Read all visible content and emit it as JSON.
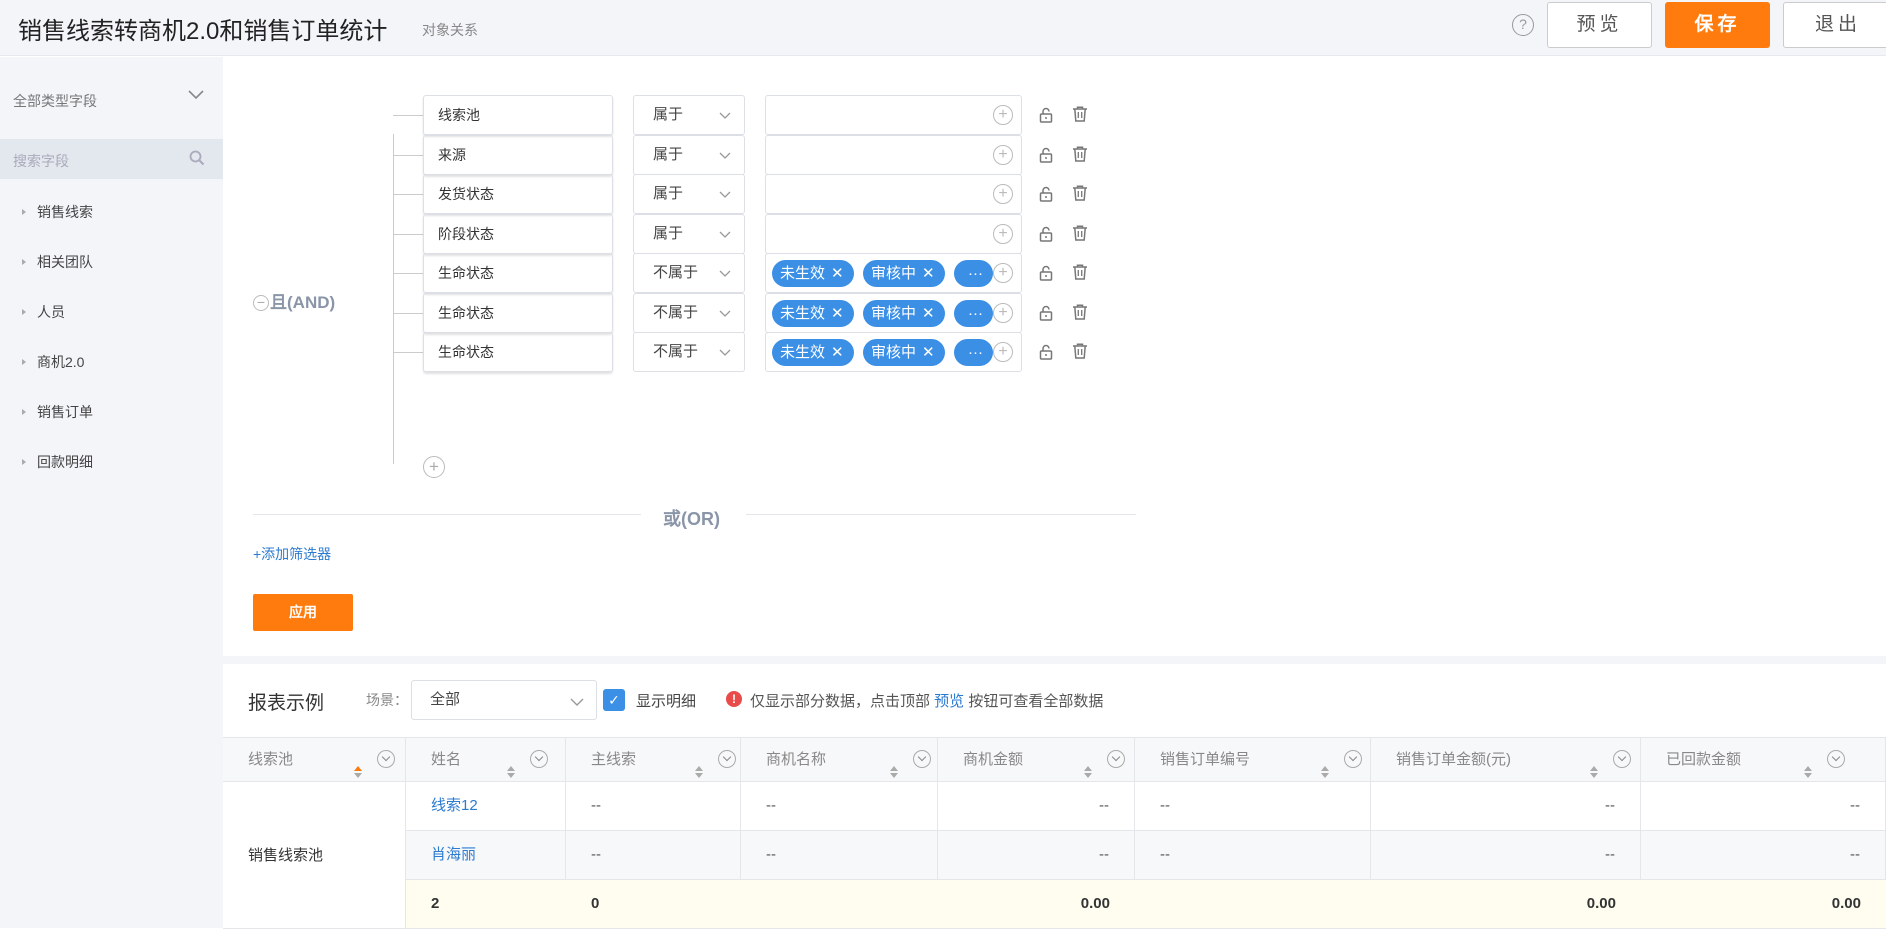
{
  "header": {
    "title": "销售线索转商机2.0和销售订单统计",
    "subtitle": "对象关系",
    "preview_label": "预览",
    "save_label": "保存",
    "exit_label": "退出",
    "help_icon": "?"
  },
  "sidebar": {
    "type_filter": "全部类型字段",
    "search_placeholder": "搜索字段",
    "items": [
      {
        "label": "销售线索"
      },
      {
        "label": "相关团队"
      },
      {
        "label": "人员"
      },
      {
        "label": "商机2.0"
      },
      {
        "label": "销售订单"
      },
      {
        "label": "回款明细"
      }
    ]
  },
  "filter": {
    "and_label": "且(AND)",
    "or_label": "或(OR)",
    "add_filter_label": "+添加筛选器",
    "apply_label": "应用",
    "conditions": [
      {
        "field": "线索池",
        "operator": "属于",
        "values": []
      },
      {
        "field": "来源",
        "operator": "属于",
        "values": []
      },
      {
        "field": "发货状态",
        "operator": "属于",
        "values": []
      },
      {
        "field": "阶段状态",
        "operator": "属于",
        "values": []
      },
      {
        "field": "生命状态",
        "operator": "不属于",
        "values": [
          "未生效",
          "审核中",
          "···"
        ]
      },
      {
        "field": "生命状态",
        "operator": "不属于",
        "values": [
          "未生效",
          "审核中",
          "···"
        ]
      },
      {
        "field": "生命状态",
        "operator": "不属于",
        "values": [
          "未生效",
          "审核中",
          "···"
        ]
      }
    ]
  },
  "report": {
    "title": "报表示例",
    "scene_label": "场景：",
    "scene_value": "全部",
    "show_detail_label": "显示明细",
    "show_detail_checked": true,
    "notice_prefix": "仅显示部分数据，点击顶部 ",
    "notice_link": "预览",
    "notice_suffix": " 按钮可查看全部数据",
    "columns": [
      "线索池",
      "姓名",
      "主线索",
      "商机名称",
      "商机金额",
      "销售订单编号",
      "销售订单金额(元)",
      "已回款金额"
    ],
    "group_value": "销售线索池",
    "rows": [
      [
        "线索12",
        "--",
        "--",
        "--",
        "--",
        "--",
        "--"
      ],
      [
        "肖海丽",
        "--",
        "--",
        "--",
        "--",
        "--",
        "--"
      ]
    ],
    "summary": [
      "2",
      "0",
      "",
      "0.00",
      "",
      "0.00",
      "0.00"
    ]
  },
  "colors": {
    "accent": "#ff7b0d",
    "tag_blue": "#3b8fe5",
    "link_blue": "#2b7bd0",
    "panel_bg": "#f3f5f9"
  }
}
